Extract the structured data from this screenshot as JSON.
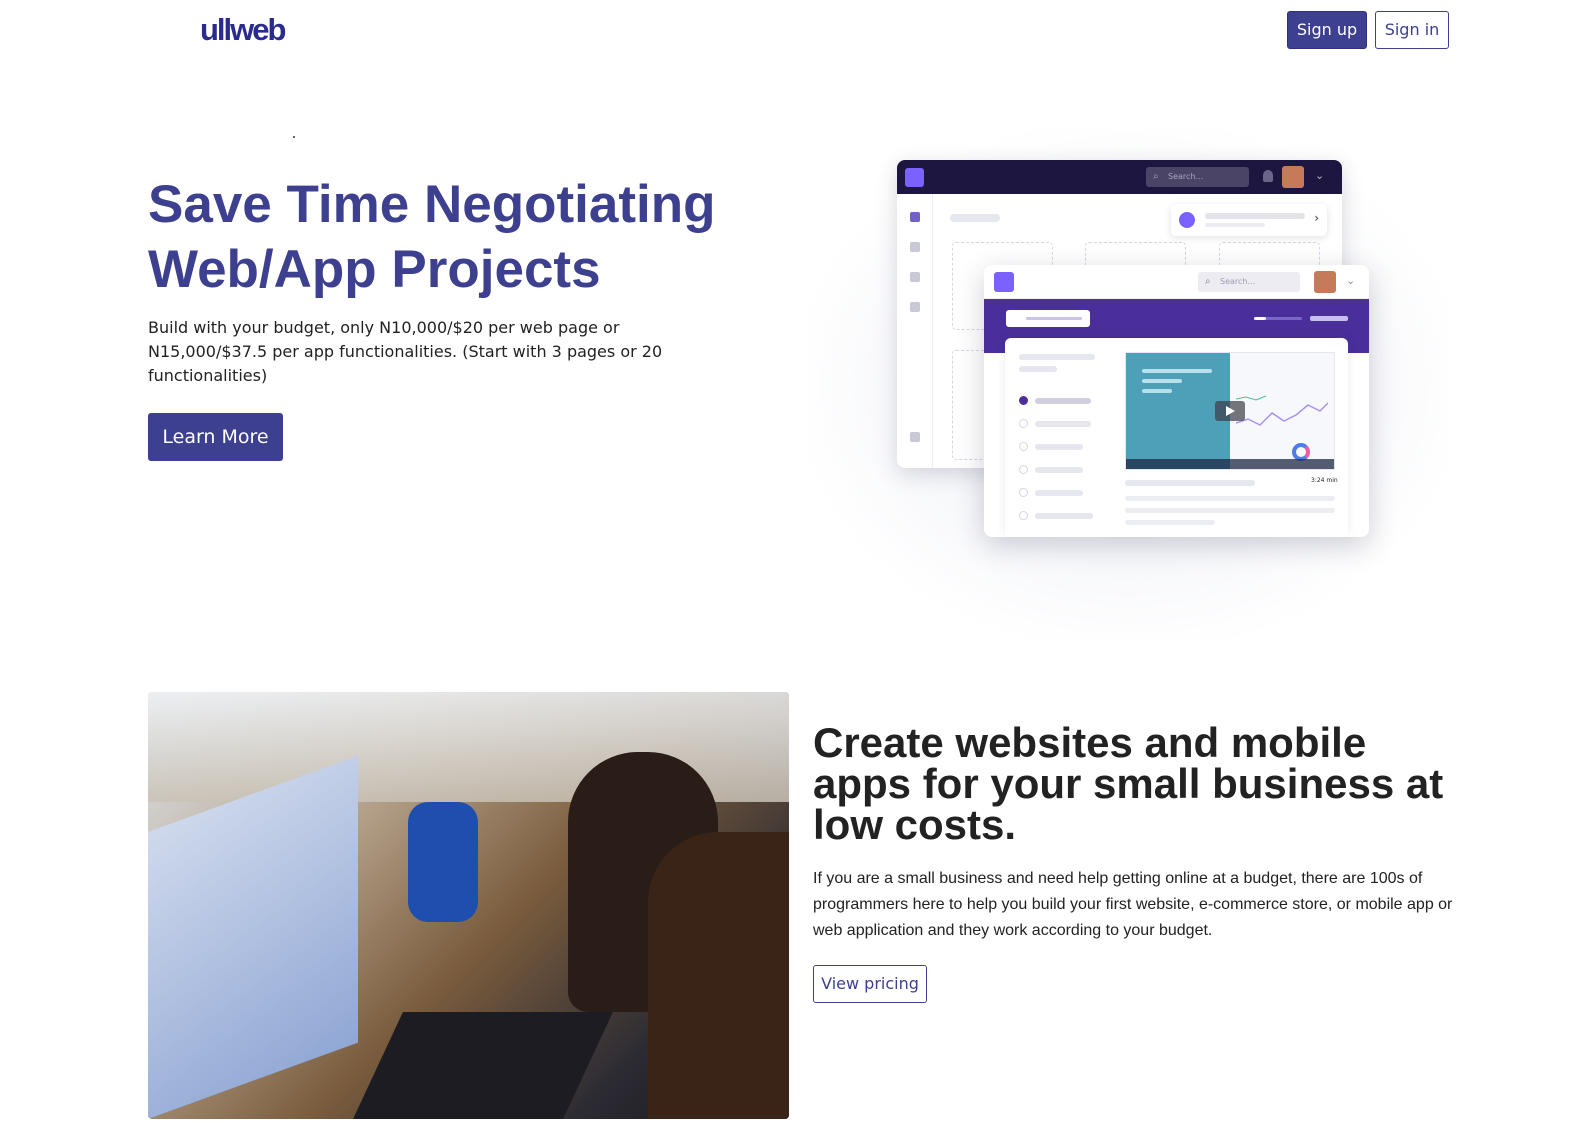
{
  "header": {
    "logo_text": "ullweb",
    "signup_label": "Sign up",
    "signin_label": "Sign in"
  },
  "hero": {
    "title": "Save Time Negotiating Web/App Projects",
    "subtitle": "Build with your budget, only N10,000/$20 per web page or N15,000/$37.5 per app functionalities. (Start with 3 pages or 20 functionalities)",
    "cta_label": "Learn More"
  },
  "illustration": {
    "back_search_placeholder": "Search...",
    "front_search_placeholder": "Search...",
    "video_duration": "3:24 min"
  },
  "section2": {
    "title": "Create websites and mobile apps for your small business at low costs.",
    "body": "If you are a small business and need help getting online at a budget, there are 100s of programmers here to help you build your first website, e-commerce store, or mobile app or web application and they work according to your budget.",
    "cta_label": "View pricing"
  },
  "colors": {
    "brand": "#3d3f8f",
    "accent_purple": "#4a2f9b"
  }
}
